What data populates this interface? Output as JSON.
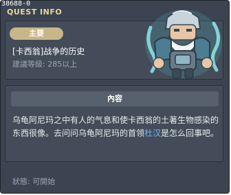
{
  "window": {
    "quest_id": "38688-0",
    "title": "QUEST INFO"
  },
  "header": {
    "badge": "主要",
    "quest_name": "[卡西翁]战争的历史",
    "level_requirement": "建議等級: 285以上"
  },
  "content": {
    "header": "內容",
    "description_before": "乌龟阿尼玛之中有人的气息和使卡西翁的土著生物感染的东西很像。去问问乌龟阿尼玛的首领",
    "npc_name": "杜汉",
    "description_after": "是怎么回事吧。"
  },
  "status": {
    "text": "狀態:  可開始"
  },
  "colors": {
    "window_bg": "#3b4450",
    "panel_bg": "#434c58",
    "badge_bg": "#c8b58a",
    "title_text": "#e8d79a",
    "npc_link": "#73b7ff"
  },
  "icons": {
    "npc": "turtle-anima-chief-portrait"
  }
}
